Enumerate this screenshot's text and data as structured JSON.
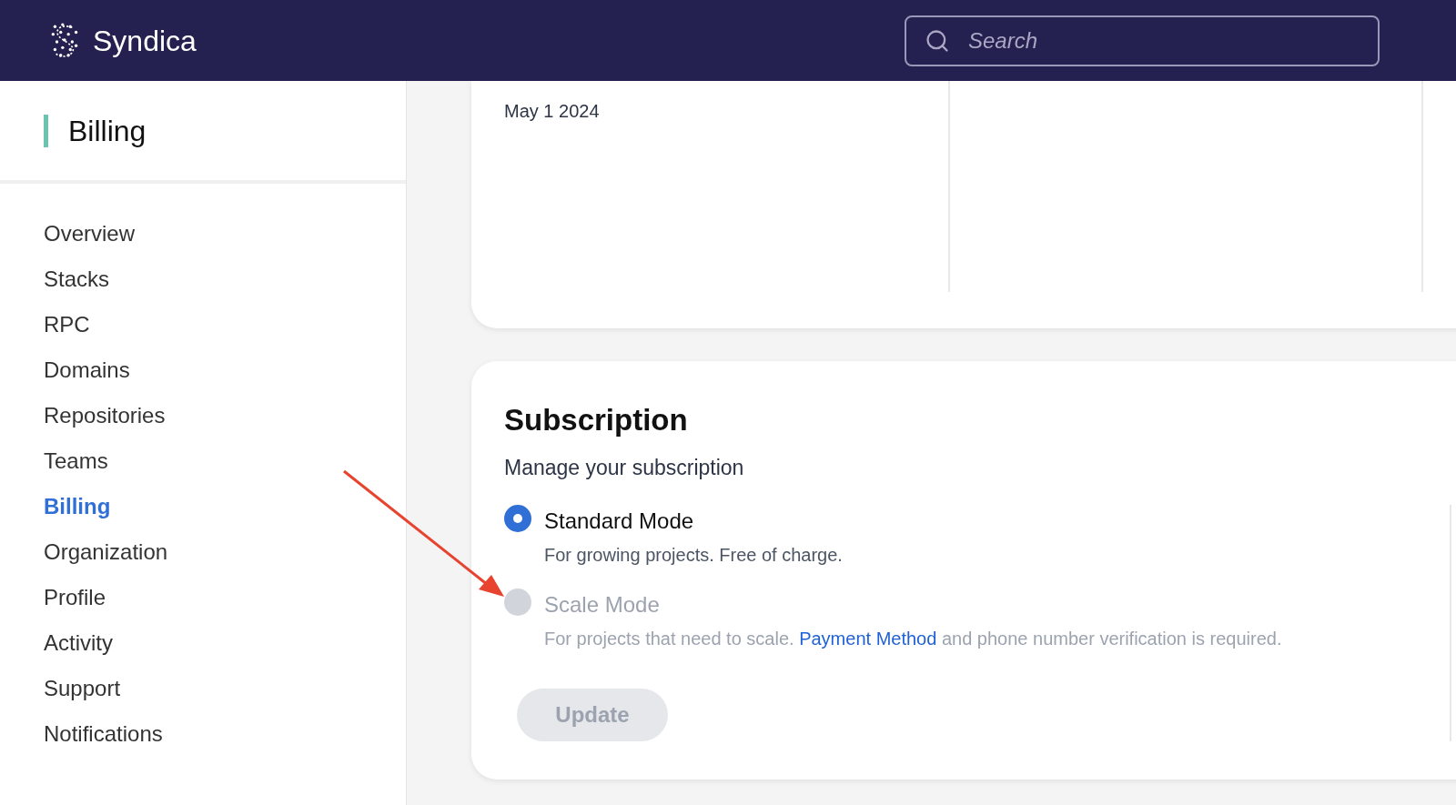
{
  "header": {
    "brand": "Syndica",
    "search": {
      "placeholder": "Search"
    }
  },
  "sidebar": {
    "title": "Billing",
    "items": [
      {
        "label": "Overview",
        "selected": false
      },
      {
        "label": "Stacks",
        "selected": false
      },
      {
        "label": "RPC",
        "selected": false
      },
      {
        "label": "Domains",
        "selected": false
      },
      {
        "label": "Repositories",
        "selected": false
      },
      {
        "label": "Teams",
        "selected": false
      },
      {
        "label": "Billing",
        "selected": true
      },
      {
        "label": "Organization",
        "selected": false
      },
      {
        "label": "Profile",
        "selected": false
      },
      {
        "label": "Activity",
        "selected": false
      },
      {
        "label": "Support",
        "selected": false
      },
      {
        "label": "Notifications",
        "selected": false
      }
    ]
  },
  "summary_card": {
    "date": "May 1 2024"
  },
  "subscription": {
    "title": "Subscription",
    "subtitle": "Manage your subscription",
    "options": [
      {
        "label": "Standard Mode",
        "description": "For growing projects. Free of charge.",
        "selected": true,
        "disabled": false
      },
      {
        "label": "Scale Mode",
        "description": "For projects that need to scale.",
        "link": "Payment Method",
        "description_after": "and phone number verification is required.",
        "selected": false,
        "disabled": true
      }
    ],
    "button": {
      "label": "Update",
      "disabled": true
    }
  }
}
